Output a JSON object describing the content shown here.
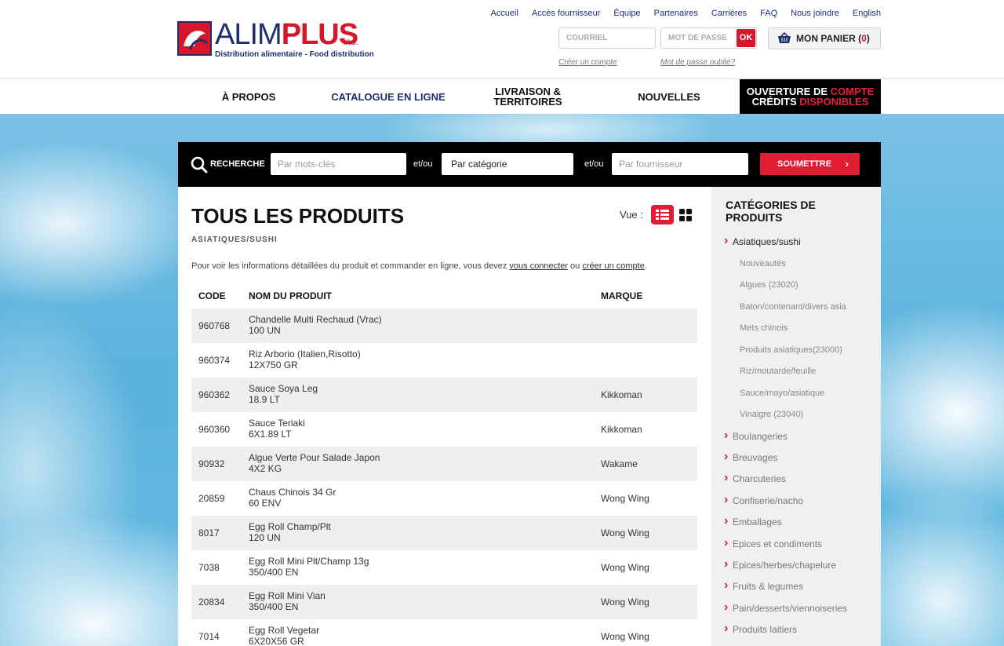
{
  "colors": {
    "accent_red": "#e11d33",
    "brand_navy": "#1e2f6e",
    "black_bar": "#000000"
  },
  "logo": {
    "word_a": "ALIM",
    "word_b": "PLUS",
    "inc": "inc.",
    "tagline": "Distribution alimentaire - Food distribution"
  },
  "topnav": [
    "Accueil",
    "Accès fournisseur",
    "Équipe",
    "Partenaires",
    "Carrières",
    "FAQ",
    "Nous joindre",
    "English"
  ],
  "login": {
    "email_placeholder": "COURRIEL",
    "password_placeholder": "MOT DE PASSE",
    "ok_label": "OK",
    "create_account": "Créer un compte",
    "forgot_password": "Mot de passe oublié?"
  },
  "cart": {
    "label": "MON PANIER",
    "count_open": "(",
    "count": "0",
    "count_close": ")",
    "icon": "basket-icon"
  },
  "mainnav": {
    "about": "À PROPOS",
    "catalog": "CATALOGUE EN LIGNE",
    "delivery_1": "LIVRAISON &",
    "delivery_2": "TERRITOIRES",
    "news": "NOUVELLES",
    "promo_1a": "OUVERTURE DE ",
    "promo_1b": "COMPTE",
    "promo_2a": "CRÉDITS ",
    "promo_2b": "DISPONIBLES"
  },
  "search": {
    "label": "RECHERCHE",
    "keywords_placeholder": "Par mots-clés",
    "and_or": "et/ou",
    "category_value": "Par catégorie",
    "supplier_placeholder": "Par fournisseur",
    "submit_label": "SOUMETTRE",
    "submit_chevron": "›"
  },
  "page": {
    "title": "TOUS LES PRODUITS",
    "subtitle": "ASIATIQUES/SUSHI",
    "view_label": "Vue :",
    "info_pre": "Pour voir les informations détaillées du produit et commander en ligne, vous devez ",
    "info_link1": "vous connecter",
    "info_mid": " ou ",
    "info_link2": "créer un compte",
    "info_post": "."
  },
  "table": {
    "headers": {
      "code": "CODE",
      "name": "NOM DU PRODUIT",
      "brand": "MARQUE"
    },
    "rows": [
      {
        "code": "960768",
        "name": "Chandelle Multi Rechaud (Vrac)",
        "size": "100 UN",
        "brand": ""
      },
      {
        "code": "960374",
        "name": "Riz Arborio (Italien,Risotto)",
        "size": "12X750 GR",
        "brand": ""
      },
      {
        "code": "960362",
        "name": "Sauce Soya Leg",
        "size": "18.9 LT",
        "brand": "Kikkoman"
      },
      {
        "code": "960360",
        "name": "Sauce Teriaki",
        "size": "6X1.89 LT",
        "brand": "Kikkoman"
      },
      {
        "code": "90932",
        "name": "Algue Verte Pour Salade Japon",
        "size": "4X2 KG",
        "brand": "Wakame"
      },
      {
        "code": "20859",
        "name": "Chaus Chinois 34 Gr",
        "size": "60 ENV",
        "brand": "Wong Wing"
      },
      {
        "code": "8017",
        "name": "Egg Roll Champ/Plt",
        "size": "120 UN",
        "brand": "Wong Wing"
      },
      {
        "code": "7038",
        "name": "Egg Roll Mini Plt/Champ 13g",
        "size": "350/400 EN",
        "brand": "Wong Wing"
      },
      {
        "code": "20834",
        "name": "Egg Roll Mini Vian",
        "size": "350/400 EN",
        "brand": "Wong Wing"
      },
      {
        "code": "7014",
        "name": "Egg Roll Vegetar",
        "size": "6X20X56 GR",
        "brand": "Wong Wing"
      }
    ]
  },
  "sidebar": {
    "title_1": "CATÉGORIES DE",
    "title_2": "PRODUITS",
    "active": "Asiatiques/sushi",
    "subcategories": [
      "Nouveautés",
      "Algues (23020)",
      "Baton/contenant/divers asia",
      "Mets chinois",
      "Produits asiatiques(23000)",
      "Riz/moutarde/feuille",
      "Sauce/mayo/asiatique",
      "Vinaigre (23040)"
    ],
    "categories": [
      "Boulangeries",
      "Breuvages",
      "Charcuteries",
      "Confiserie/nacho",
      "Emballages",
      "Epices et condiments",
      "Epices/herbes/chapelure",
      "Fruits & legumes",
      "Pain/desserts/viennoiseries",
      "Produits laitiers"
    ]
  }
}
